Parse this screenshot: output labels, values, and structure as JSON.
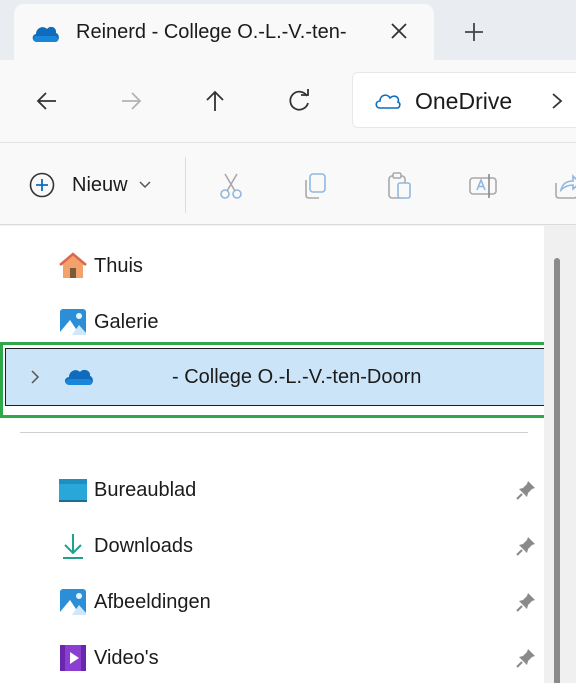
{
  "tab": {
    "title": "Reinerd - College O.-L.-V.-ten-",
    "icon": "onedrive-cloud-icon"
  },
  "nav": {
    "back_icon": "arrow-left-icon",
    "forward_icon": "arrow-right-icon",
    "up_icon": "arrow-up-icon",
    "refresh_icon": "refresh-icon",
    "address": "OneDrive"
  },
  "commandbar": {
    "new_label": "Nieuw",
    "icons": [
      "cut-icon",
      "copy-icon",
      "paste-icon",
      "rename-icon",
      "share-icon"
    ]
  },
  "navpane": {
    "items_top": [
      {
        "label": "Thuis",
        "icon": "home-icon"
      },
      {
        "label": "Galerie",
        "icon": "gallery-icon"
      }
    ],
    "selected": {
      "label": "- College O.-L.-V.-ten-Doorn",
      "icon": "onedrive-cloud-icon"
    },
    "quick_access": [
      {
        "label": "Bureaublad",
        "icon": "desktop-icon"
      },
      {
        "label": "Downloads",
        "icon": "download-icon"
      },
      {
        "label": "Afbeeldingen",
        "icon": "pictures-icon"
      },
      {
        "label": "Video's",
        "icon": "videos-icon"
      }
    ]
  },
  "colors": {
    "selection_bg": "#cce4f7",
    "highlight_border": "#2ea84a",
    "onedrive_blue": "#0f6cbd"
  }
}
